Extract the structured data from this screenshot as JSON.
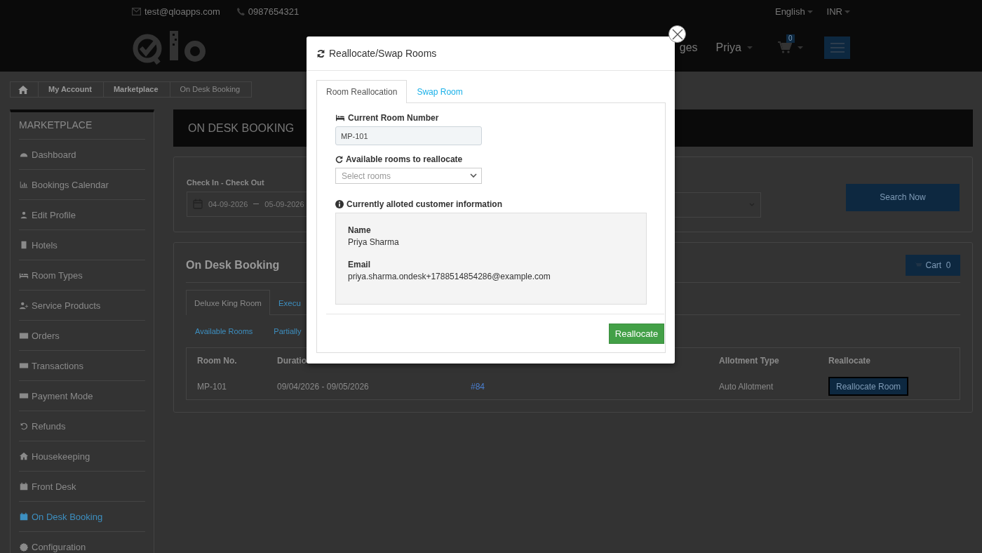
{
  "top_bar": {
    "email": "test@qloapps.com",
    "phone": "0987654321",
    "language": "English",
    "currency": "INR"
  },
  "header": {
    "nav_item": "ges",
    "user": "Priya",
    "cart_count": "0"
  },
  "breadcrumb": [
    "My Account",
    "Marketplace",
    "On Desk Booking"
  ],
  "sidebar": {
    "title": "MARKETPLACE",
    "items": [
      {
        "label": "Dashboard",
        "selected": false
      },
      {
        "label": "Bookings Calendar",
        "selected": false
      },
      {
        "label": "Edit Profile",
        "selected": false
      },
      {
        "label": "Hotels",
        "selected": false
      },
      {
        "label": "Room Types",
        "selected": false
      },
      {
        "label": "Service Products",
        "selected": false
      },
      {
        "label": "Orders",
        "selected": false
      },
      {
        "label": "Transactions",
        "selected": false
      },
      {
        "label": "Payment Mode",
        "selected": false
      },
      {
        "label": "Refunds",
        "selected": false
      },
      {
        "label": "Housekeeping",
        "selected": false
      },
      {
        "label": "Front Desk",
        "selected": false
      },
      {
        "label": "On Desk Booking",
        "selected": true
      },
      {
        "label": "Configuration",
        "selected": false
      }
    ]
  },
  "page_title": "ON DESK BOOKING",
  "search": {
    "label": "Check In - Check Out",
    "date_from": "04-09-2026",
    "date_to": "05-09-2026",
    "button": "Search Now"
  },
  "booking": {
    "title": "On Desk Booking",
    "cart_label": "Cart",
    "cart_count": "0",
    "room_tabs": [
      {
        "label": "Deluxe King Room",
        "selected": true
      },
      {
        "label": "Execu",
        "selected": false
      }
    ],
    "sub_tabs": [
      {
        "label": "Available Rooms"
      },
      {
        "label": "Partially"
      }
    ],
    "columns": [
      "Room No.",
      "Duratio",
      "Allotment Type",
      "Reallocate"
    ],
    "rows": [
      {
        "room": "MP-101",
        "duration": "09/04/2026 - 09/05/2026",
        "order": "#84",
        "allotment": "Auto Allotment",
        "action": "Reallocate Room"
      }
    ]
  },
  "modal": {
    "title": "Reallocate/Swap Rooms",
    "tabs": [
      {
        "label": "Room Reallocation",
        "selected": true
      },
      {
        "label": "Swap Room",
        "selected": false
      }
    ],
    "current_room_label": "Current Room Number",
    "current_room": "MP-101",
    "available_label": "Available rooms to reallocate",
    "available_placeholder": "Select rooms",
    "customer_label": "Currently alloted customer information",
    "customer": [
      {
        "label": "Name",
        "value": "Priya Sharma"
      },
      {
        "label": "Email",
        "value": "priya.sharma.ondesk+1788514854286@example.com"
      }
    ],
    "button": "Reallocate"
  }
}
